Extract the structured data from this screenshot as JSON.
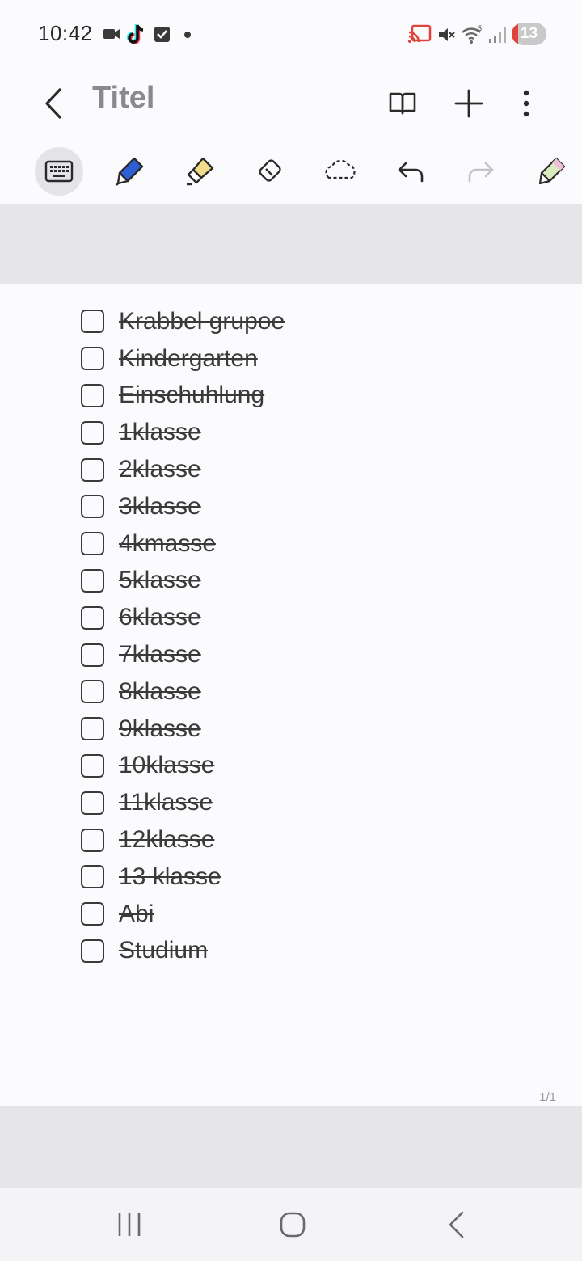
{
  "status_bar": {
    "time": "10:42",
    "battery_level": "13",
    "icons": [
      "video-camera-icon",
      "tiktok-icon",
      "checkbox-notification-icon",
      "dot-icon",
      "cast-icon",
      "mute-icon",
      "wifi-icon",
      "signal-icon"
    ]
  },
  "app_bar": {
    "title": "Titel",
    "back_icon": "chevron-left-icon",
    "actions": [
      "book-icon",
      "plus-icon",
      "more-vert-icon"
    ]
  },
  "toolbar": {
    "tools": [
      "keyboard-icon",
      "pen-icon",
      "highlighter-icon",
      "eraser-icon",
      "lasso-icon",
      "undo-icon",
      "redo-icon",
      "color-pen-icon"
    ],
    "active_tool": "keyboard-icon",
    "pen_color": "#2f5fd6",
    "highlighter_color": "#f2dc8c"
  },
  "note": {
    "items": [
      "Krabbel grupoe",
      "Kindergarten",
      "Einschuhlung",
      "1klasse",
      "2klasse",
      "3klasse",
      "4kmasse",
      "5klasse",
      "6klasse",
      "7klasse",
      "8klasse",
      "9klasse",
      "10klasse",
      "11klasse",
      "12klasse",
      "13 klasse",
      "Abi",
      "Studium"
    ],
    "page_indicator": "1/1"
  },
  "nav_bar": {
    "buttons": [
      "recent-apps-icon",
      "home-icon",
      "back-icon"
    ]
  }
}
